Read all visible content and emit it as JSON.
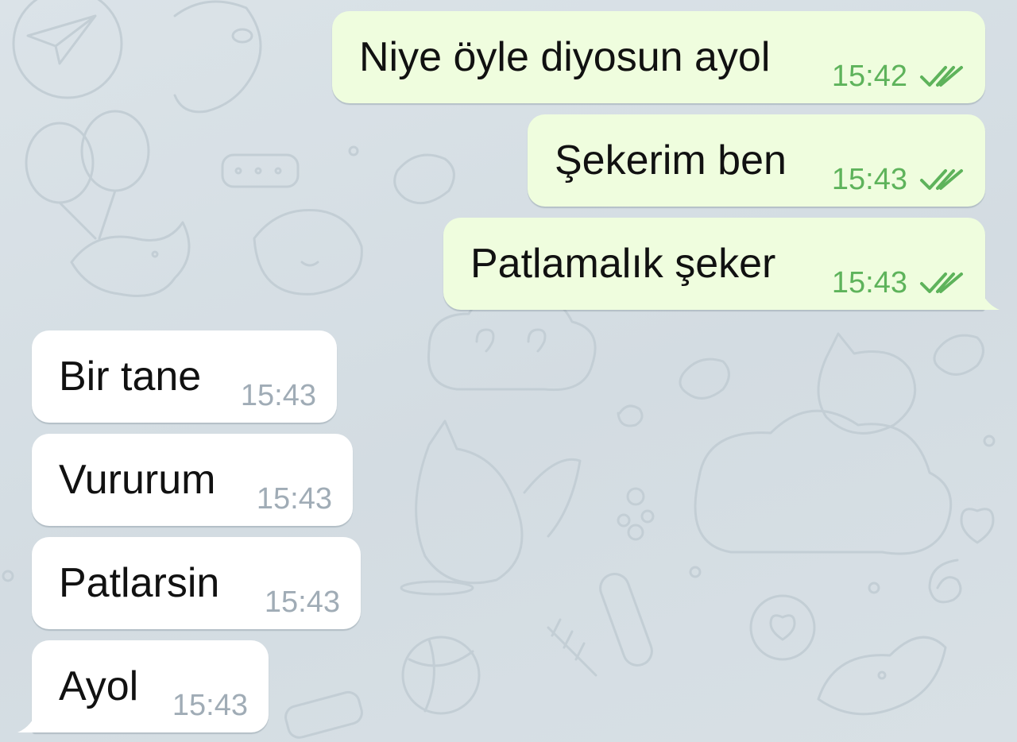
{
  "chat": {
    "outgoing": [
      {
        "text": "Niye öyle diyosun ayol",
        "time": "15:42",
        "status_icon": "double-check-icon"
      },
      {
        "text": "Şekerim ben",
        "time": "15:43",
        "status_icon": "double-check-icon"
      },
      {
        "text": "Patlamalık şeker",
        "time": "15:43",
        "status_icon": "double-check-icon"
      }
    ],
    "incoming": [
      {
        "text": "Bir tane",
        "time": "15:43"
      },
      {
        "text": "Vururum",
        "time": "15:43"
      },
      {
        "text": "Patlarsin",
        "time": "15:43"
      },
      {
        "text": "Ayol",
        "time": "15:43"
      }
    ]
  },
  "colors": {
    "background": "#d7dfe4",
    "outgoing_bubble": "#effdde",
    "incoming_bubble": "#ffffff",
    "outgoing_time": "#5eb35b",
    "incoming_time": "#a0acb6",
    "check_marks": "#5eb35b"
  }
}
